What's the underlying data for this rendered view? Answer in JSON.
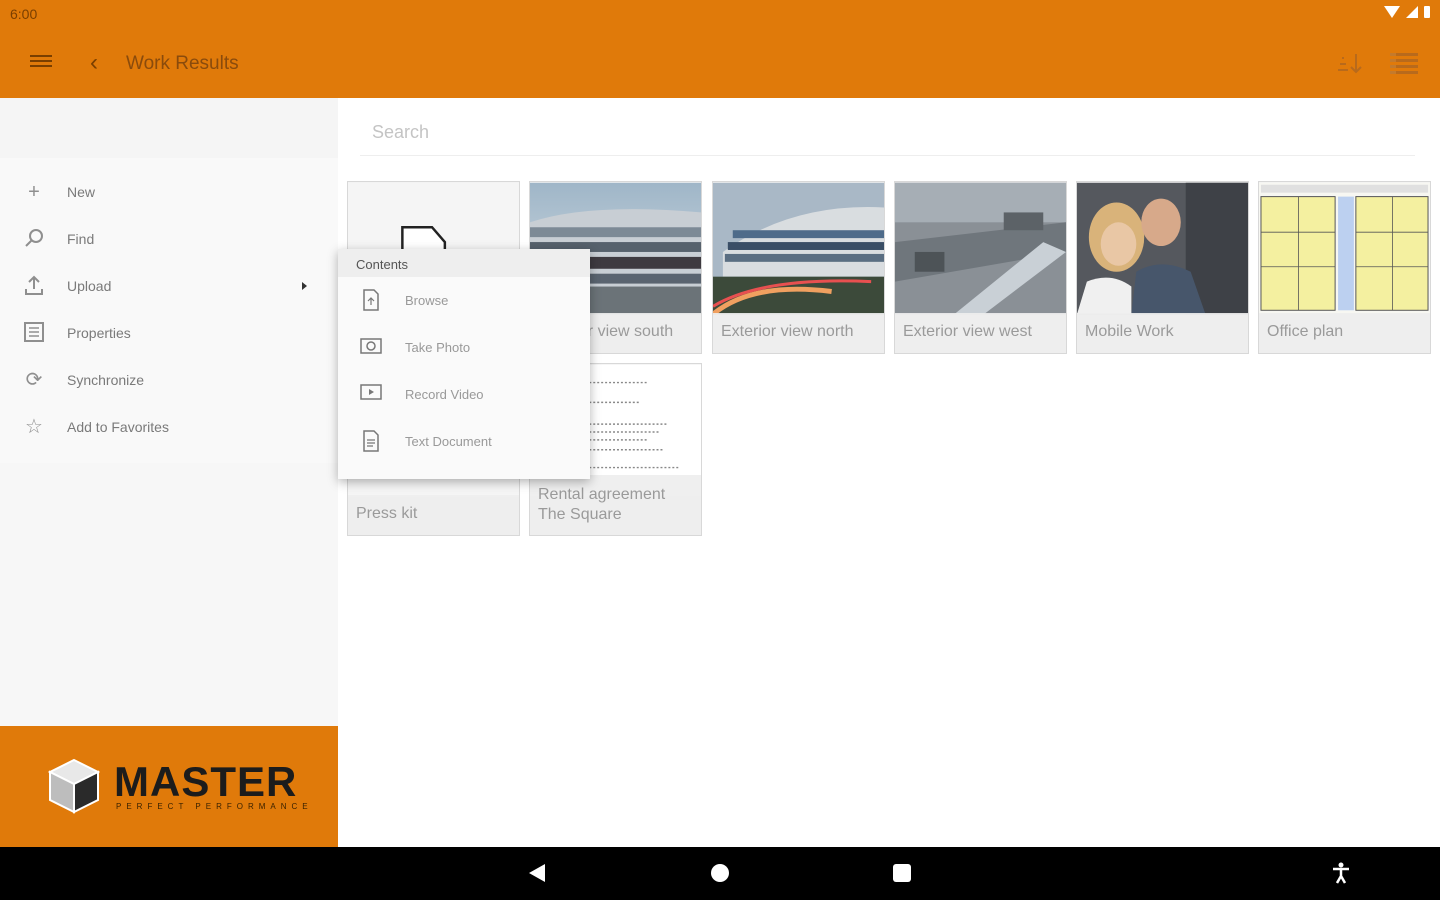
{
  "status_bar": {
    "time": "6:00",
    "icons": [
      "wifi-icon",
      "signal-icon",
      "battery-icon"
    ]
  },
  "app_bar": {
    "title": "Work Results",
    "menu_icon": "hamburger-icon",
    "back_icon": "chevron-left-icon",
    "sort_icon": "sort-icon",
    "view_icon": "list-view-icon",
    "color": "#E07A0A"
  },
  "sidebar": {
    "items": [
      {
        "label": "New",
        "icon": "plus-icon"
      },
      {
        "label": "Find",
        "icon": "search-icon"
      },
      {
        "label": "Upload",
        "icon": "upload-icon",
        "has_submenu": true
      },
      {
        "label": "Properties",
        "icon": "properties-icon"
      },
      {
        "label": "Synchronize",
        "icon": "sync-icon"
      },
      {
        "label": "Add to Favorites",
        "icon": "favorite-add-icon"
      }
    ],
    "logo": {
      "name": "MASTER",
      "tagline": "PERFECT PERFORMANCE"
    }
  },
  "search": {
    "placeholder": "Search"
  },
  "tiles": [
    {
      "label": "Press kit",
      "kind": "document"
    },
    {
      "label": "Exterior view south",
      "kind": "photo-building"
    },
    {
      "label": "Exterior view north",
      "kind": "photo-building-night"
    },
    {
      "label": "Exterior view west",
      "kind": "photo-aerial"
    },
    {
      "label": "Mobile Work",
      "kind": "photo-people"
    },
    {
      "label": "Office plan",
      "kind": "floor-plan"
    },
    {
      "label": "Rental agreement The Square",
      "kind": "text-document"
    }
  ],
  "popup_menu": {
    "header": "Contents",
    "items": [
      {
        "label": "Browse",
        "icon": "file-browse-icon"
      },
      {
        "label": "Take Photo",
        "icon": "camera-icon"
      },
      {
        "label": "Record Video",
        "icon": "video-icon"
      },
      {
        "label": "Text Document",
        "icon": "text-document-icon"
      }
    ]
  },
  "nav_bar": {
    "icons": [
      "back-triangle-icon",
      "home-circle-icon",
      "recents-square-icon",
      "accessibility-icon"
    ]
  }
}
